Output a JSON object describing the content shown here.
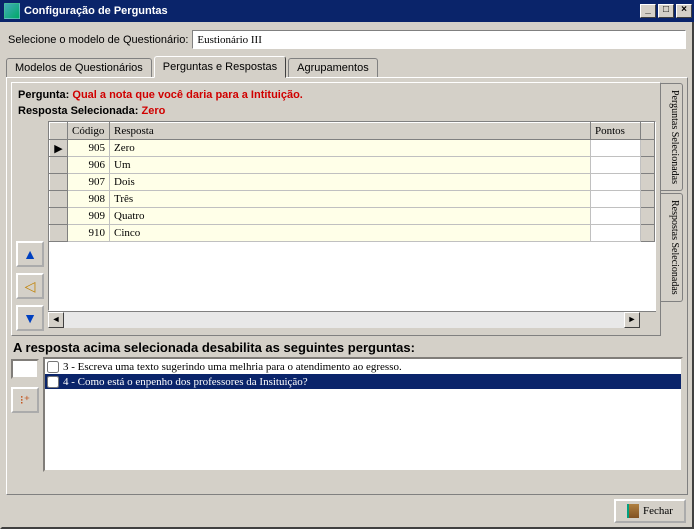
{
  "window": {
    "title": "Configuração de Perguntas",
    "minimize": "_",
    "maximize": "□",
    "close": "×"
  },
  "selector": {
    "label": "Selecione o modelo de Questionário:",
    "value": "Eustionário III"
  },
  "tabs": [
    {
      "label": "Modelos de Questionários",
      "active": false
    },
    {
      "label": "Perguntas e Respostas",
      "active": true
    },
    {
      "label": "Agrupamentos",
      "active": false
    }
  ],
  "pergunta": {
    "label": "Pergunta:",
    "text": "Qual a nota que você daria para a Intituição."
  },
  "resposta_sel": {
    "label": "Resposta Selecionada:",
    "text": "Zero"
  },
  "grid": {
    "headers": {
      "codigo": "Código",
      "resposta": "Resposta",
      "pontos": "Pontos"
    },
    "rows": [
      {
        "marker": "▶",
        "codigo": "905",
        "resposta": "Zero",
        "pontos": ""
      },
      {
        "marker": "",
        "codigo": "906",
        "resposta": "Um",
        "pontos": ""
      },
      {
        "marker": "",
        "codigo": "907",
        "resposta": "Dois",
        "pontos": ""
      },
      {
        "marker": "",
        "codigo": "908",
        "resposta": "Três",
        "pontos": ""
      },
      {
        "marker": "",
        "codigo": "909",
        "resposta": "Quatro",
        "pontos": ""
      },
      {
        "marker": "",
        "codigo": "910",
        "resposta": "Cinco",
        "pontos": ""
      }
    ]
  },
  "vtabs": [
    {
      "label": "Perguntas Selecionadas"
    },
    {
      "label": "Respostas Selecionadas"
    }
  ],
  "disable_heading": "A resposta acima selecionada desabilita as seguintes perguntas:",
  "disable_list": [
    {
      "checked": false,
      "text": "3 - Escreva uma texto sugerindo uma melhria para o atendimento ao egresso.",
      "selected": false
    },
    {
      "checked": false,
      "text": "4 - Como está o enpenho dos professores da Insituição?",
      "selected": true
    }
  ],
  "nav": {
    "up": "▲",
    "bell": "◁",
    "down": "▼"
  },
  "footer": {
    "close_label": "Fechar"
  },
  "scroll": {
    "left": "◄",
    "right": "►"
  }
}
